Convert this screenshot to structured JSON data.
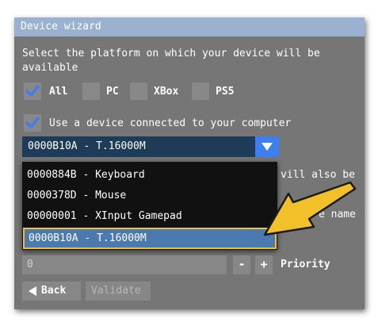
{
  "window": {
    "title": "Device wizard"
  },
  "platform": {
    "label": "Select the platform on which your device will be available",
    "label_line1": "Select the platform on which your device will be",
    "label_line2": "available",
    "options": [
      {
        "label": "All",
        "checked": true
      },
      {
        "label": "PC",
        "checked": false
      },
      {
        "label": "XBox",
        "checked": false
      },
      {
        "label": "PS5",
        "checked": false
      }
    ]
  },
  "connected": {
    "label": "Use a device connected to your computer",
    "checked": true
  },
  "device_select": {
    "selected": "0000B10A - T.16000M",
    "options": [
      "0000884B - Keyboard",
      "0000378D - Mouse",
      "00000001 - XInput Gamepad",
      "0000B10A - T.16000M"
    ],
    "highlighted_index": 3
  },
  "hidden_fragments": {
    "will_also_be": "vill also be",
    "name_fragment": "e name"
  },
  "priority": {
    "value": "0",
    "label": "Priority",
    "minus": "-",
    "plus": "+"
  },
  "buttons": {
    "back": "Back",
    "validate": "Validate"
  },
  "colors": {
    "panel": "#767676",
    "title_bar": "#9ab2cf",
    "check": "#3d7ff0",
    "highlight_border": "#f2c12a",
    "arrow": "#f2c12a"
  }
}
